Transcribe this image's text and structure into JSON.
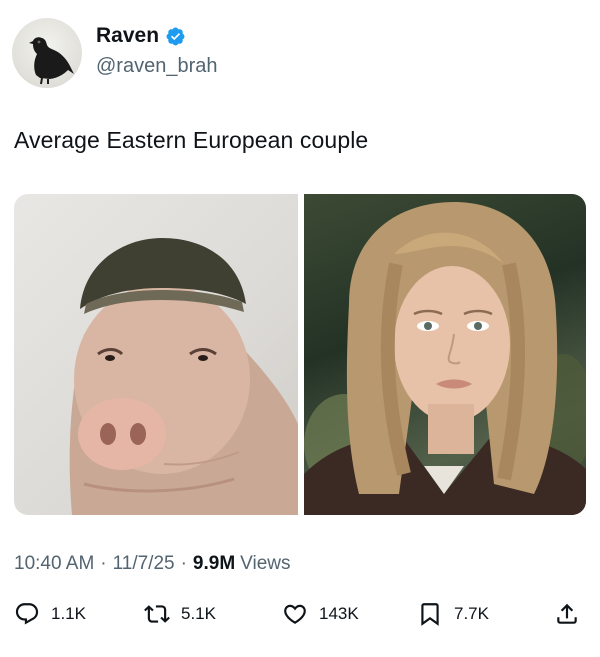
{
  "author": {
    "display_name": "Raven",
    "handle": "@raven_brah",
    "verified": true,
    "avatar_icon": "raven-avatar"
  },
  "tweet": {
    "text": "Average Eastern European couple"
  },
  "media": {
    "left_image": "pig-with-haircut-photo",
    "right_image": "woman-portrait-photo"
  },
  "meta": {
    "time": "10:40 AM",
    "separator": "·",
    "date": "11/7/25",
    "views_count": "9.9M",
    "views_label": "Views"
  },
  "actions": {
    "replies": "1.1K",
    "retweets": "5.1K",
    "likes": "143K",
    "bookmarks": "7.7K"
  },
  "colors": {
    "text_primary": "#0f1419",
    "text_secondary": "#536471",
    "verified_blue": "#1d9bf0"
  }
}
